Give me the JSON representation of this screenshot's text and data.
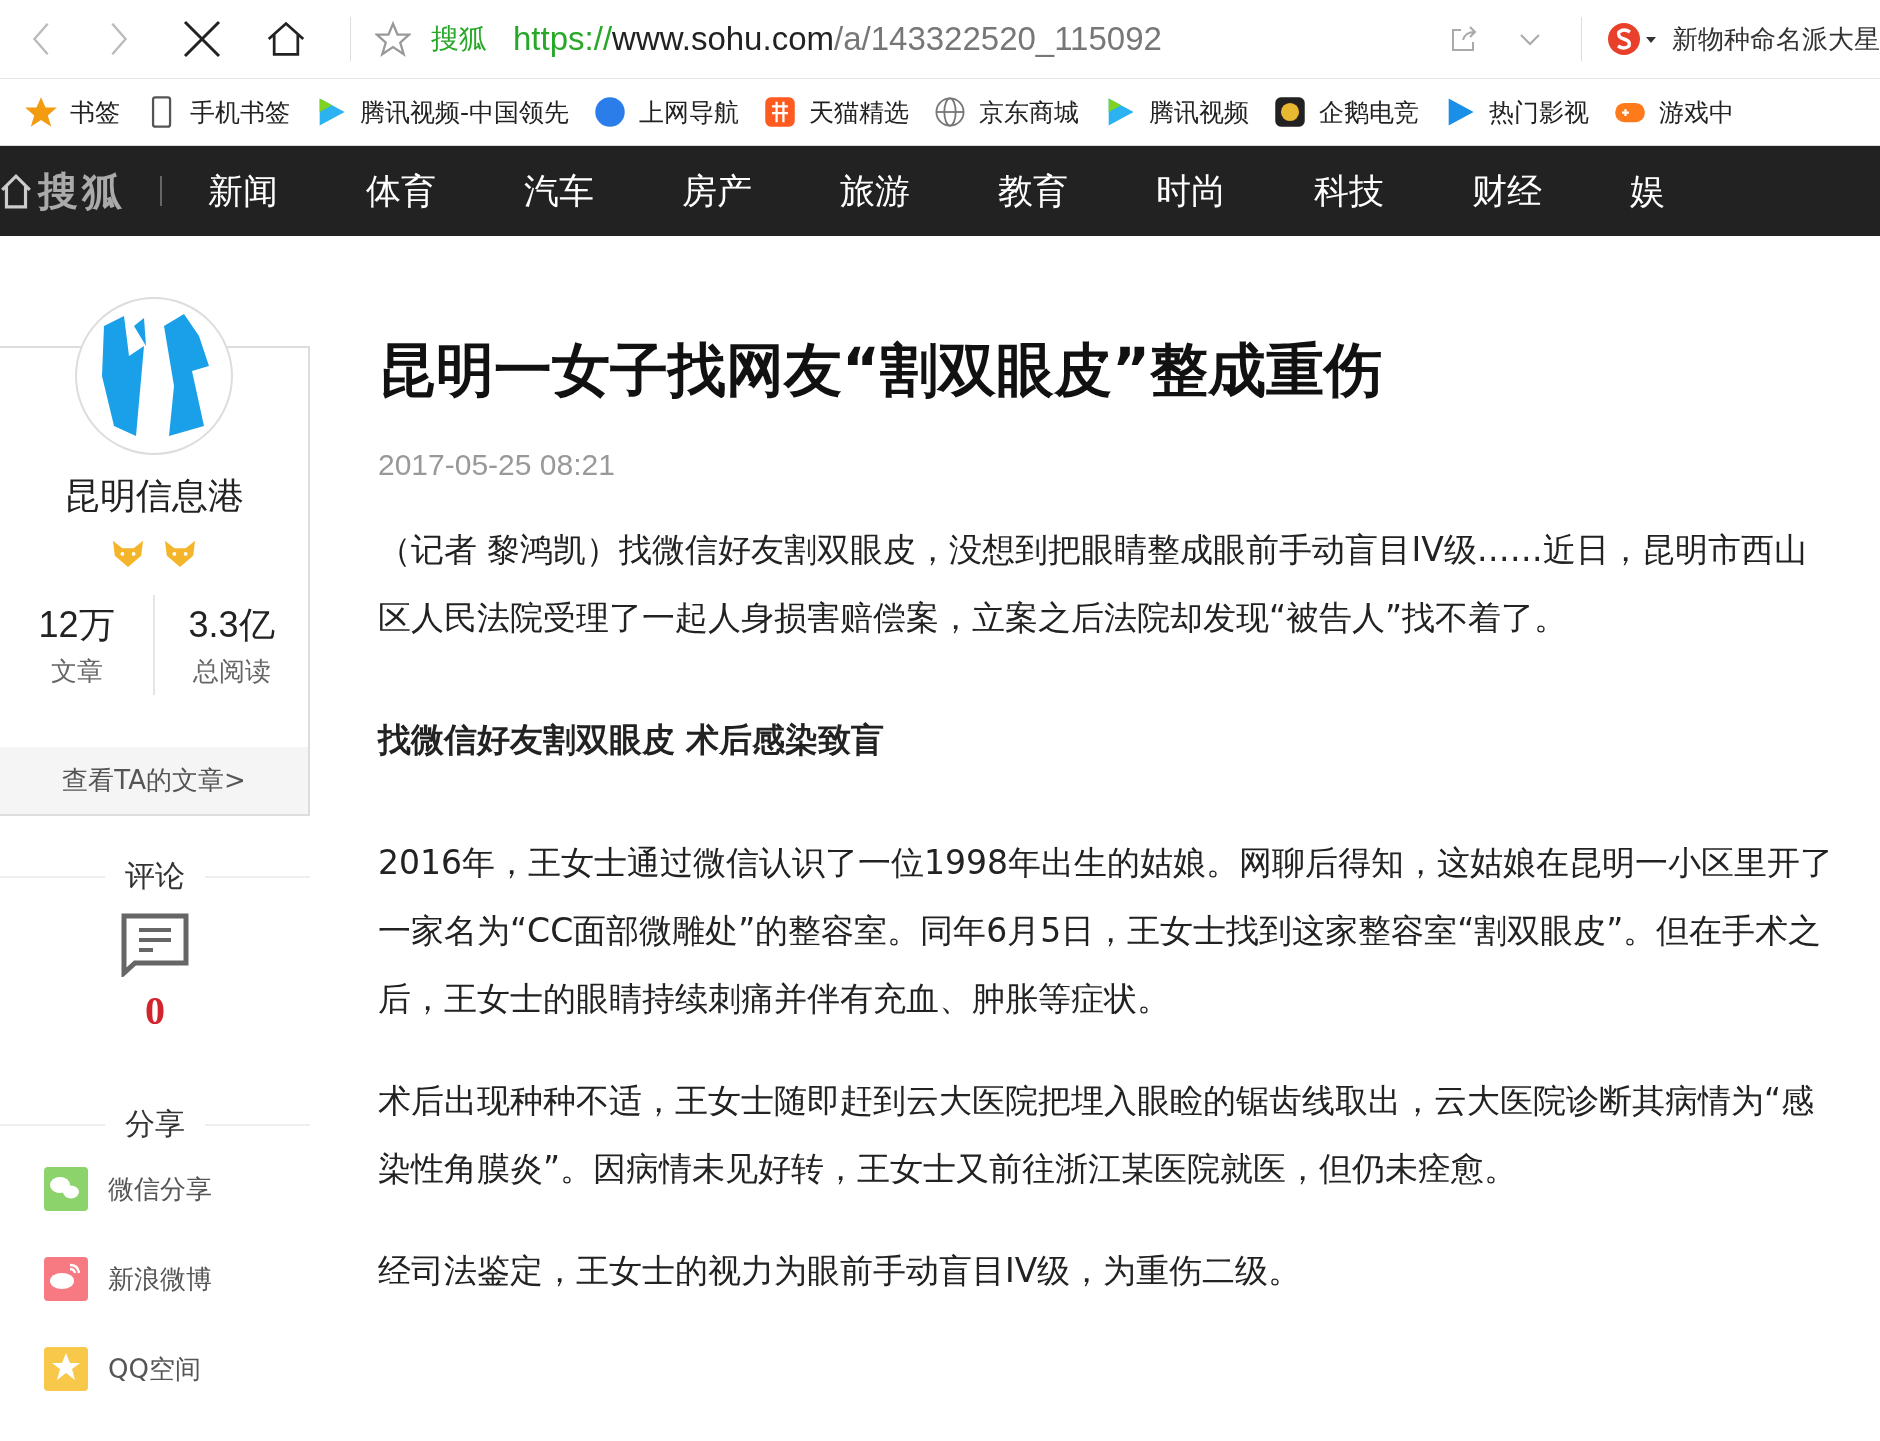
{
  "browser": {
    "address": {
      "site_label": "搜狐",
      "url_scheme": "https://",
      "url_host": "www.sohu.com",
      "url_path": "/a/143322520_115092"
    },
    "profile_name": "新物种命名派大星"
  },
  "bookmarks": [
    {
      "label": "书签",
      "kind": "star"
    },
    {
      "label": "手机书签",
      "kind": "phone"
    },
    {
      "label": "腾讯视频-中国领先",
      "kind": "video"
    },
    {
      "label": "上网导航",
      "kind": "ie"
    },
    {
      "label": "天猫精选",
      "kind": "tao"
    },
    {
      "label": "京东商城",
      "kind": "globe"
    },
    {
      "label": "腾讯视频",
      "kind": "video"
    },
    {
      "label": "企鹅电竞",
      "kind": "penguin"
    },
    {
      "label": "热门影视",
      "kind": "play"
    },
    {
      "label": "游戏中",
      "kind": "game"
    }
  ],
  "nav": {
    "logo": "搜狐",
    "items": [
      "新闻",
      "体育",
      "汽车",
      "房产",
      "旅游",
      "教育",
      "时尚",
      "科技",
      "财经",
      "娱"
    ]
  },
  "author": {
    "name": "昆明信息港",
    "stats": [
      {
        "value": "12万",
        "label": "文章"
      },
      {
        "value": "3.3亿",
        "label": "总阅读"
      }
    ],
    "link": "查看TA的文章>"
  },
  "comments": {
    "heading": "评论",
    "count": "0"
  },
  "share": {
    "heading": "分享",
    "items": [
      {
        "label": "微信分享",
        "kind": "wechat"
      },
      {
        "label": "新浪微博",
        "kind": "weibo"
      },
      {
        "label": "QQ空间",
        "kind": "qzone"
      }
    ]
  },
  "article": {
    "title": "昆明一女子找网友“割双眼皮”整成重伤",
    "date": "2017-05-25 08:21",
    "blocks": [
      {
        "kind": "paragraph",
        "text": "（记者 黎鸿凯）找微信好友割双眼皮，没想到把眼睛整成眼前手动盲目IV级……近日，昆明市西山区人民法院受理了一起人身损害赔偿案，立案之后法院却发现“被告人”找不着了。"
      },
      {
        "kind": "subheading",
        "text": "找微信好友割双眼皮 术后感染致盲"
      },
      {
        "kind": "paragraph",
        "text": "2016年，王女士通过微信认识了一位1998年出生的姑娘。网聊后得知，这姑娘在昆明一小区里开了一家名为“CC面部微雕处”的整容室。同年6月5日，王女士找到这家整容室“割双眼皮”。但在手术之后，王女士的眼睛持续刺痛并伴有充血、肿胀等症状。"
      },
      {
        "kind": "paragraph",
        "text": "术后出现种种不适，王女士随即赶到云大医院把埋入眼睑的锯齿线取出，云大医院诊断其病情为“感染性角膜炎”。因病情未见好转，王女士又前往浙江某医院就医，但仍未痊愈。"
      },
      {
        "kind": "paragraph",
        "text": "经司法鉴定，王女士的视力为眼前手动盲目IV级，为重伤二级。"
      }
    ]
  }
}
